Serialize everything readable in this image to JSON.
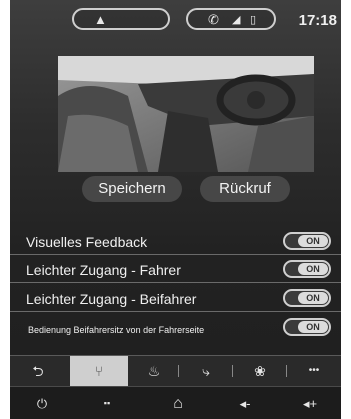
{
  "status": {
    "time": "17:18",
    "nav_icon": "navigation-arrow-icon",
    "phone_icons": [
      "phone-icon",
      "signal-icon",
      "battery-icon"
    ]
  },
  "actions": {
    "save_label": "Speichern",
    "recall_label": "Rückruf"
  },
  "settings": [
    {
      "label": "Visuelles Feedback",
      "state": "ON"
    },
    {
      "label": "Leichter Zugang - Fahrer",
      "state": "ON"
    },
    {
      "label": "Leichter Zugang - Beifahrer",
      "state": "ON"
    },
    {
      "label": "Bedienung Beifahrersitz von der Fahrerseite",
      "state": "ON"
    }
  ],
  "tabs": [
    {
      "icon": "back-icon",
      "glyph": "⮌"
    },
    {
      "icon": "seat-position-icon",
      "glyph": "⑂",
      "active": true
    },
    {
      "icon": "seat-massage-icon",
      "glyph": "♨"
    },
    {
      "icon": "seat-back-icon",
      "glyph": "⤷"
    },
    {
      "icon": "seat-ventilation-icon",
      "glyph": "❀"
    },
    {
      "icon": "more-icon",
      "glyph": "•••"
    }
  ],
  "bottom": [
    {
      "icon": "power-icon",
      "glyph": "⏻"
    },
    {
      "icon": "apps-grid-icon",
      "glyph": "▪▪"
    },
    {
      "icon": "home-icon",
      "glyph": "⌂"
    },
    {
      "icon": "volume-down-icon",
      "glyph": "◂-"
    },
    {
      "icon": "volume-up-icon",
      "glyph": "◂+"
    }
  ]
}
